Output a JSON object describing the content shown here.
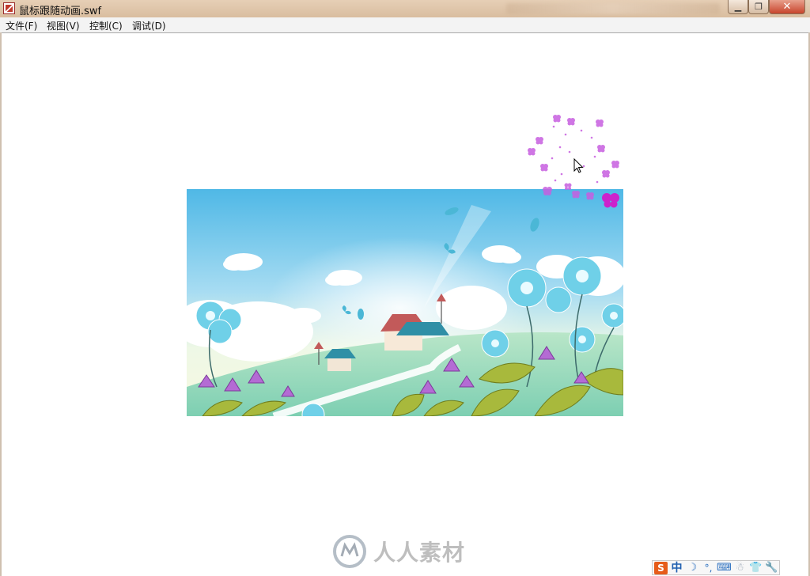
{
  "window": {
    "title": "鼠标跟随动画.swf",
    "controls": {
      "minimize": "▁",
      "maximize": "❐",
      "close": "✕"
    }
  },
  "menu": {
    "items": [
      {
        "label": "文件(F)"
      },
      {
        "label": "视图(V)"
      },
      {
        "label": "控制(C)"
      },
      {
        "label": "调试(D)"
      }
    ]
  },
  "stage": {
    "content": "flash-animation",
    "scene_icons": [
      "sky",
      "clouds",
      "hill",
      "path",
      "cottages",
      "cyan-flowers",
      "purple-bellflowers",
      "green-leaves",
      "butterflies"
    ],
    "trail_color": "#c75fe0",
    "trail_accent": "#cc22cc"
  },
  "watermark": {
    "text": "人人素材"
  },
  "ime_toolbar": {
    "items": [
      {
        "name": "sogou-icon",
        "glyph": "S"
      },
      {
        "name": "chinese-mode-icon",
        "glyph": "中"
      },
      {
        "name": "half-width-icon",
        "glyph": "☽"
      },
      {
        "name": "punctuation-icon",
        "glyph": "°,"
      },
      {
        "name": "keyboard-icon",
        "glyph": "⌨"
      },
      {
        "name": "person-icon",
        "glyph": "☃"
      },
      {
        "name": "skin-icon",
        "glyph": "👕"
      },
      {
        "name": "settings-wrench-icon",
        "glyph": "🔧"
      }
    ]
  }
}
